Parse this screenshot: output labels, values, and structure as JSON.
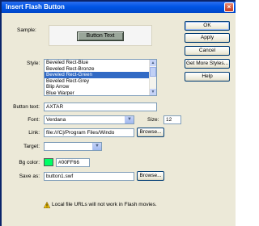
{
  "window": {
    "title": "Insert Flash Button",
    "close_glyph": "×"
  },
  "labels": {
    "sample": "Sample:",
    "style": "Style:",
    "button_text": "Button text:",
    "font": "Font:",
    "size": "Size:",
    "link": "Link:",
    "target": "Target:",
    "bg_color": "Bg color:",
    "save_as": "Save as:"
  },
  "sample": {
    "button_label": "Button Text"
  },
  "style_list": {
    "items": [
      "Beveled Rect-Blue",
      "Beveled Rect-Bronze",
      "Beveled Rect-Green",
      "Beveled Rect-Grey",
      "Blip Arrow",
      "Blue Warper"
    ],
    "selected_index": 2
  },
  "fields": {
    "button_text": "AXTAR",
    "font": "Verdana",
    "size": "12",
    "link": "file:///C|/Program Files/Windo",
    "target": "",
    "bg_color": "#00FF66",
    "save_as": "button1.swf"
  },
  "buttons": {
    "ok": "OK",
    "apply": "Apply",
    "cancel": "Cancel",
    "get_more_styles": "Get More Styles...",
    "help": "Help",
    "browse_link": "Browse...",
    "browse_save": "Browse..."
  },
  "warning": {
    "text": "Local file URLs will not work in Flash movies."
  },
  "colors": {
    "selection": "#316ac5",
    "swatch": "#00ff66",
    "title_bar": "#0055e5"
  },
  "icons": {
    "warning": "warning-icon",
    "dropdown": "chevron-down-icon"
  }
}
